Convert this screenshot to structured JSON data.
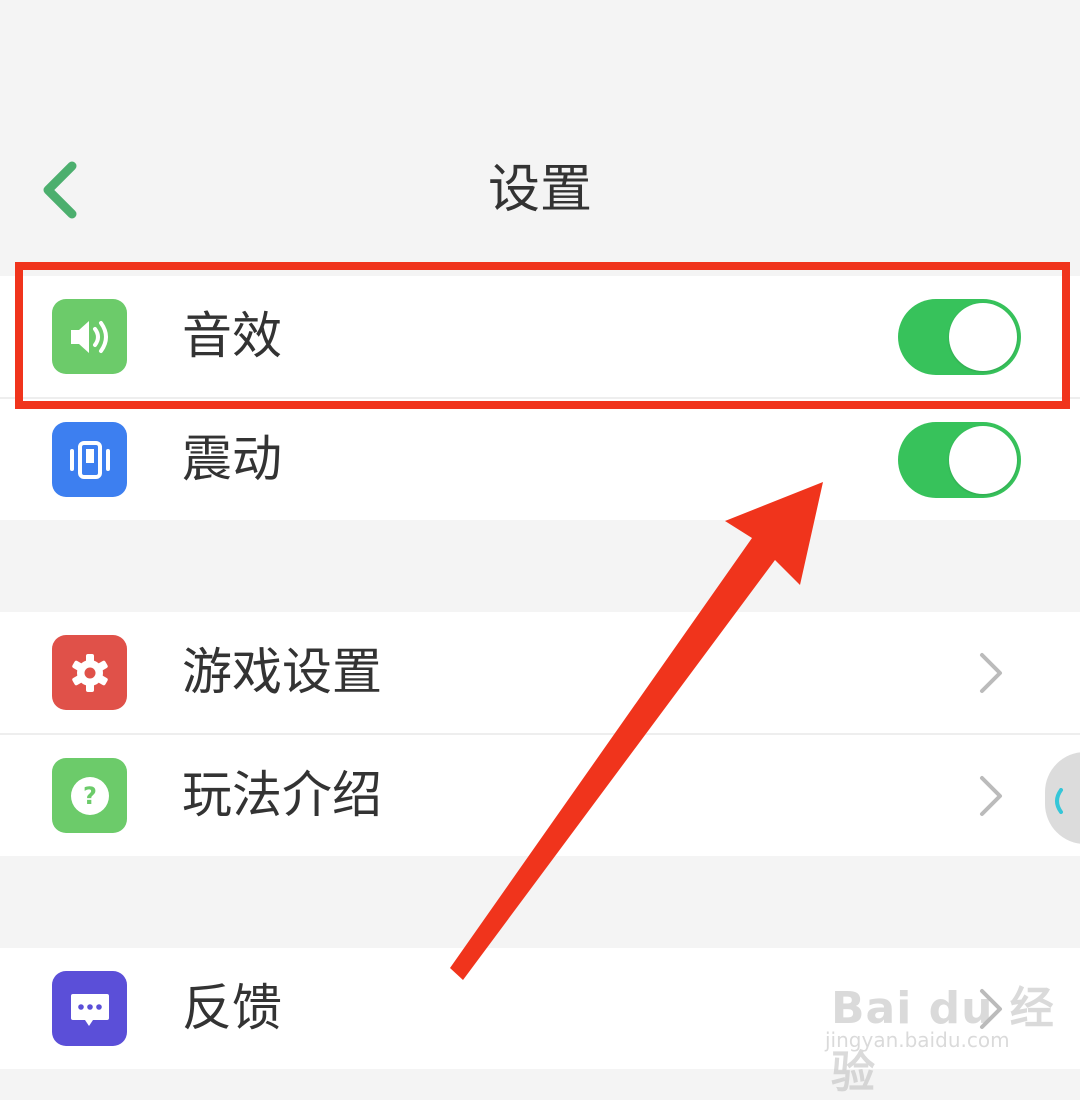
{
  "header": {
    "title": "设置",
    "back_icon": "chevron-left-icon",
    "accent_color": "#4caf6e"
  },
  "group_sound": {
    "rows": [
      {
        "label": "音效",
        "icon": "speaker-icon",
        "icon_color": "#6ccb6a",
        "toggle_on": true
      },
      {
        "label": "震动",
        "icon": "vibrate-icon",
        "icon_color": "#3d7ff0",
        "toggle_on": true
      }
    ]
  },
  "group_game": {
    "rows": [
      {
        "label": "游戏设置",
        "icon": "gear-icon",
        "icon_color": "#e05149"
      },
      {
        "label": "玩法介绍",
        "icon": "question-icon",
        "icon_color": "#6ccb6a"
      }
    ]
  },
  "group_feedback": {
    "rows": [
      {
        "label": "反馈",
        "icon": "chat-icon",
        "icon_color": "#5b4fd8"
      }
    ]
  },
  "colors": {
    "toggle_on": "#37c25b",
    "annotation_red": "#f0341c",
    "background": "#f4f4f4"
  },
  "watermark": {
    "logo": "Bai du 经验",
    "sub": "jingyan.baidu.com"
  }
}
